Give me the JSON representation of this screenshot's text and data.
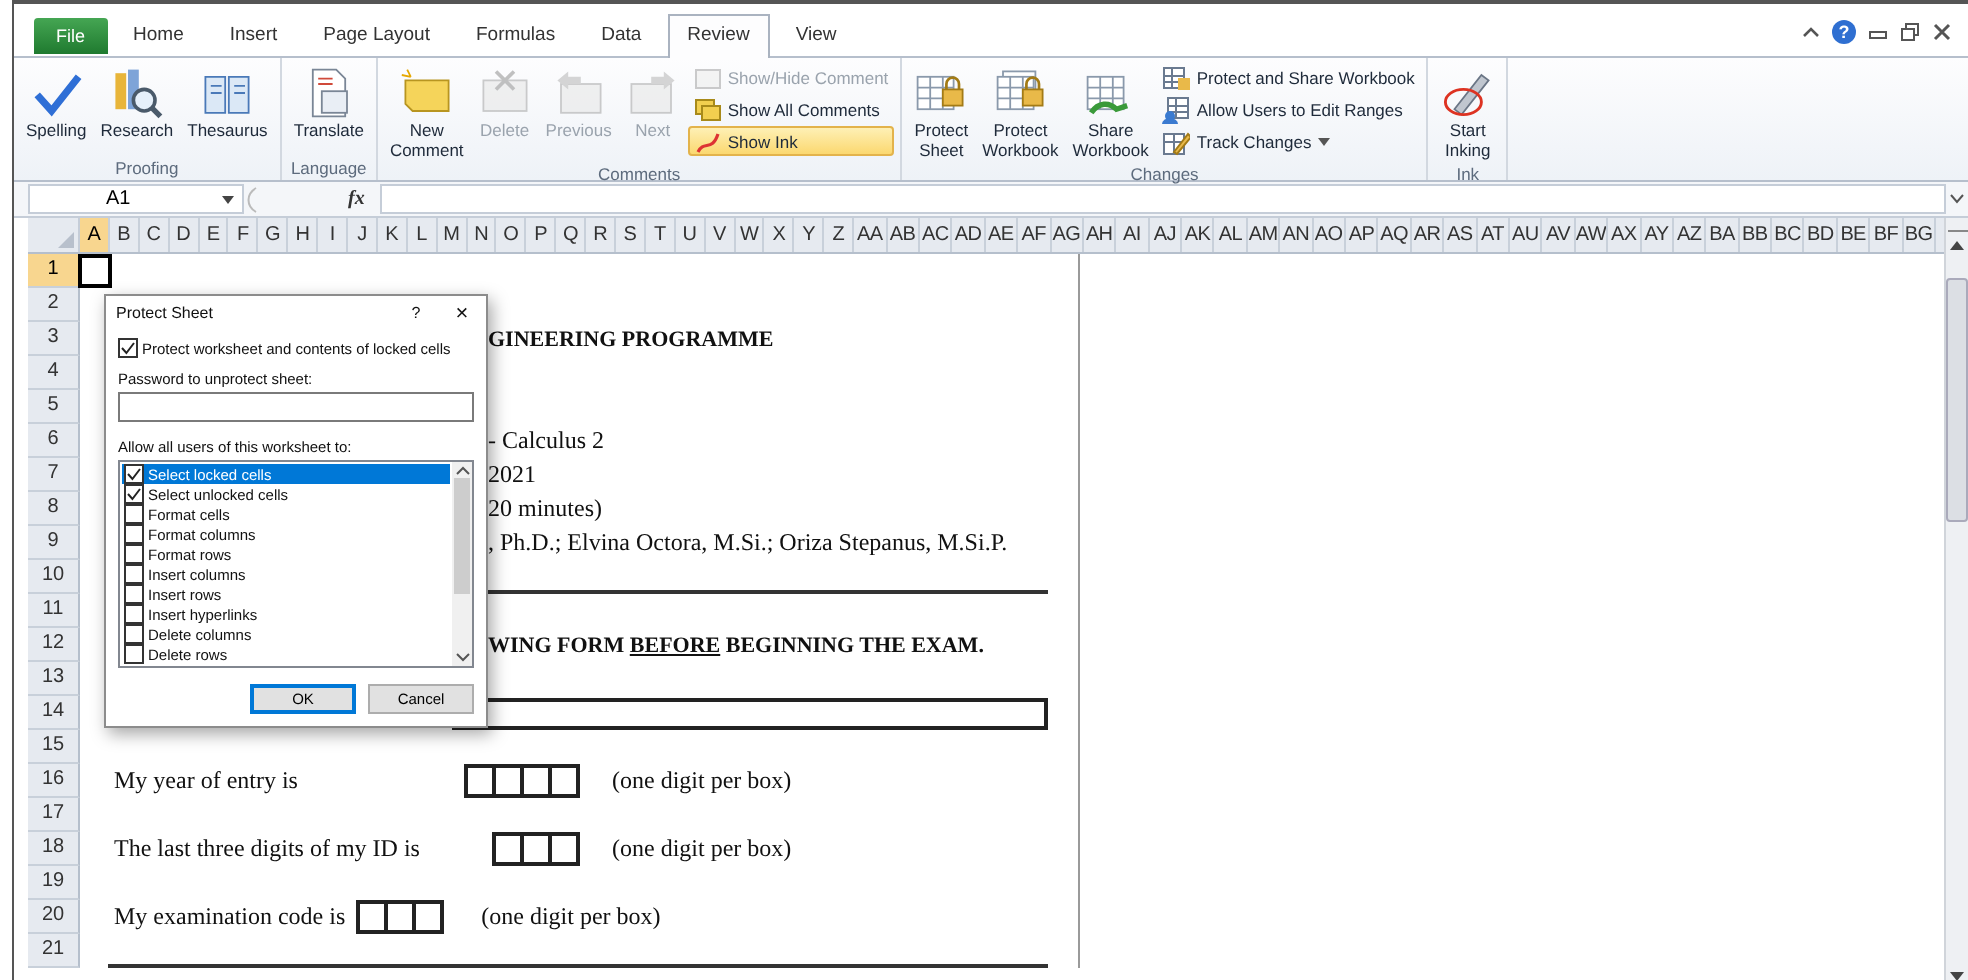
{
  "tabs": [
    {
      "label": "File",
      "kind": "file",
      "selected": false
    },
    {
      "label": "Home",
      "kind": "tab",
      "selected": false
    },
    {
      "label": "Insert",
      "kind": "tab",
      "selected": false
    },
    {
      "label": "Page Layout",
      "kind": "tab",
      "selected": false
    },
    {
      "label": "Formulas",
      "kind": "tab",
      "selected": false
    },
    {
      "label": "Data",
      "kind": "tab",
      "selected": false
    },
    {
      "label": "Review",
      "kind": "tab",
      "selected": true
    },
    {
      "label": "View",
      "kind": "tab",
      "selected": false
    }
  ],
  "help": "?",
  "ribbon": [
    {
      "label": "Proofing",
      "commands": [
        {
          "kind": "large",
          "lines": [
            "Spelling"
          ],
          "disabled": false,
          "on": false,
          "dropdown": false
        },
        {
          "kind": "large",
          "lines": [
            "Research"
          ],
          "disabled": false,
          "on": false,
          "dropdown": false
        },
        {
          "kind": "large",
          "lines": [
            "Thesaurus"
          ],
          "disabled": false,
          "on": false,
          "dropdown": false
        }
      ]
    },
    {
      "label": "Language",
      "commands": [
        {
          "kind": "large",
          "lines": [
            "Translate"
          ],
          "disabled": false,
          "on": false,
          "dropdown": false
        }
      ]
    },
    {
      "label": "Comments",
      "commands": [
        {
          "kind": "large",
          "lines": [
            "New",
            "Comment"
          ],
          "disabled": false,
          "on": false,
          "dropdown": false
        },
        {
          "kind": "large",
          "lines": [
            "Delete"
          ],
          "disabled": true,
          "on": false,
          "dropdown": false
        },
        {
          "kind": "large",
          "lines": [
            "Previous"
          ],
          "disabled": true,
          "on": false,
          "dropdown": false
        },
        {
          "kind": "large",
          "lines": [
            "Next"
          ],
          "disabled": true,
          "on": false,
          "dropdown": false
        },
        {
          "kind": "small",
          "lines": [
            "Show/Hide Comment"
          ],
          "disabled": true,
          "on": false,
          "dropdown": false
        },
        {
          "kind": "small",
          "lines": [
            "Show All Comments"
          ],
          "disabled": false,
          "on": false,
          "dropdown": false
        },
        {
          "kind": "small",
          "lines": [
            "Show Ink"
          ],
          "disabled": false,
          "on": true,
          "dropdown": false
        }
      ]
    },
    {
      "label": "Changes",
      "commands": [
        {
          "kind": "large",
          "lines": [
            "Protect",
            "Sheet"
          ],
          "disabled": false,
          "on": false,
          "dropdown": false
        },
        {
          "kind": "large",
          "lines": [
            "Protect",
            "Workbook"
          ],
          "disabled": false,
          "on": false,
          "dropdown": false
        },
        {
          "kind": "large",
          "lines": [
            "Share",
            "Workbook"
          ],
          "disabled": false,
          "on": false,
          "dropdown": false
        },
        {
          "kind": "small",
          "lines": [
            "Protect and Share Workbook"
          ],
          "disabled": false,
          "on": false,
          "dropdown": false
        },
        {
          "kind": "small",
          "lines": [
            "Allow Users to Edit Ranges"
          ],
          "disabled": false,
          "on": false,
          "dropdown": false
        },
        {
          "kind": "small",
          "lines": [
            "Track Changes"
          ],
          "disabled": false,
          "on": false,
          "dropdown": true
        }
      ]
    },
    {
      "label": "Ink",
      "commands": [
        {
          "kind": "large",
          "lines": [
            "Start",
            "Inking"
          ],
          "disabled": false,
          "on": false,
          "dropdown": false
        }
      ]
    }
  ],
  "formula_bar": {
    "name_box": "A1",
    "function_label": "fx"
  },
  "columns": [
    {
      "label": "A",
      "selected": true
    },
    {
      "label": "B",
      "selected": false
    },
    {
      "label": "C",
      "selected": false
    },
    {
      "label": "D",
      "selected": false
    },
    {
      "label": "E",
      "selected": false
    },
    {
      "label": "F",
      "selected": false
    },
    {
      "label": "G",
      "selected": false
    },
    {
      "label": "H",
      "selected": false
    },
    {
      "label": "I",
      "selected": false
    },
    {
      "label": "J",
      "selected": false
    },
    {
      "label": "K",
      "selected": false
    },
    {
      "label": "L",
      "selected": false
    },
    {
      "label": "M",
      "selected": false
    },
    {
      "label": "N",
      "selected": false
    },
    {
      "label": "O",
      "selected": false
    },
    {
      "label": "P",
      "selected": false
    },
    {
      "label": "Q",
      "selected": false
    },
    {
      "label": "R",
      "selected": false
    },
    {
      "label": "S",
      "selected": false
    },
    {
      "label": "T",
      "selected": false
    },
    {
      "label": "U",
      "selected": false
    },
    {
      "label": "V",
      "selected": false
    },
    {
      "label": "W",
      "selected": false
    },
    {
      "label": "X",
      "selected": false
    },
    {
      "label": "Y",
      "selected": false
    },
    {
      "label": "Z",
      "selected": false
    },
    {
      "label": "AA",
      "selected": false
    },
    {
      "label": "AB",
      "selected": false
    },
    {
      "label": "AC",
      "selected": false
    },
    {
      "label": "AD",
      "selected": false
    },
    {
      "label": "AE",
      "selected": false
    },
    {
      "label": "AF",
      "selected": false
    },
    {
      "label": "AG",
      "selected": false
    },
    {
      "label": "AH",
      "selected": false
    },
    {
      "label": "AI",
      "selected": false
    },
    {
      "label": "AJ",
      "selected": false
    },
    {
      "label": "AK",
      "selected": false
    },
    {
      "label": "AL",
      "selected": false
    },
    {
      "label": "AM",
      "selected": false
    },
    {
      "label": "AN",
      "selected": false
    },
    {
      "label": "AO",
      "selected": false
    },
    {
      "label": "AP",
      "selected": false
    },
    {
      "label": "AQ",
      "selected": false
    },
    {
      "label": "AR",
      "selected": false
    },
    {
      "label": "AS",
      "selected": false
    },
    {
      "label": "AT",
      "selected": false
    },
    {
      "label": "AU",
      "selected": false
    },
    {
      "label": "AV",
      "selected": false
    },
    {
      "label": "AW",
      "selected": false
    },
    {
      "label": "AX",
      "selected": false
    },
    {
      "label": "AY",
      "selected": false
    },
    {
      "label": "AZ",
      "selected": false
    },
    {
      "label": "BA",
      "selected": false
    },
    {
      "label": "BB",
      "selected": false
    },
    {
      "label": "BC",
      "selected": false
    },
    {
      "label": "BD",
      "selected": false
    },
    {
      "label": "BE",
      "selected": false
    },
    {
      "label": "BF",
      "selected": false
    },
    {
      "label": "BG",
      "selected": false
    }
  ],
  "rows": [
    {
      "label": "1",
      "selected": true
    },
    {
      "label": "2",
      "selected": false
    },
    {
      "label": "3",
      "selected": false,
      "content": [
        {
          "kind": "bold-text",
          "text": "GINEERING PROGRAMME"
        }
      ]
    },
    {
      "label": "4",
      "selected": false
    },
    {
      "label": "5",
      "selected": false
    },
    {
      "label": "6",
      "selected": false,
      "content": [
        {
          "kind": "text",
          "text": "- Calculus 2"
        }
      ]
    },
    {
      "label": "7",
      "selected": false,
      "content": [
        {
          "kind": "text",
          "text": "2021"
        }
      ]
    },
    {
      "label": "8",
      "selected": false,
      "content": [
        {
          "kind": "text",
          "text": "20 minutes)"
        }
      ]
    },
    {
      "label": "9",
      "selected": false,
      "content": [
        {
          "kind": "text",
          "text": ", Ph.D.; Elvina Octora, M.Si.; Oriza Stepanus, M.Si.P."
        }
      ]
    },
    {
      "label": "10",
      "selected": false,
      "content": [
        {
          "kind": "rule"
        }
      ]
    },
    {
      "label": "11",
      "selected": false
    },
    {
      "label": "12",
      "selected": false,
      "content": [
        {
          "kind": "notice",
          "before": "WING FORM ",
          "underlined": "BEFORE",
          "after": " BEGINNING THE EXAM."
        }
      ]
    },
    {
      "label": "13",
      "selected": false
    },
    {
      "label": "14",
      "selected": false,
      "content": [
        {
          "kind": "name-field"
        }
      ]
    },
    {
      "label": "15",
      "selected": false
    },
    {
      "label": "16",
      "selected": false,
      "content": [
        {
          "kind": "digit-row",
          "label": "My year of entry is",
          "boxes": [
            {
              "kind": "empty"
            },
            {
              "kind": "empty"
            },
            {
              "kind": "empty"
            },
            {
              "kind": "empty"
            }
          ],
          "hint": "(one digit per box)"
        }
      ]
    },
    {
      "label": "17",
      "selected": false
    },
    {
      "label": "18",
      "selected": false,
      "content": [
        {
          "kind": "digit-row",
          "label": "The last three digits of my ID is",
          "boxes": [
            {
              "kind": "empty"
            },
            {
              "kind": "empty"
            },
            {
              "kind": "empty"
            }
          ],
          "hint": "(one digit per box)"
        }
      ]
    },
    {
      "label": "19",
      "selected": false
    },
    {
      "label": "20",
      "selected": false,
      "content": [
        {
          "kind": "digit-row-inline",
          "label": "My examination code is",
          "boxes": [
            {
              "kind": "empty"
            },
            {
              "kind": "empty"
            },
            {
              "kind": "empty"
            }
          ],
          "hint": "(one digit per box)"
        }
      ]
    },
    {
      "label": "21",
      "selected": false,
      "content": [
        {
          "kind": "rule"
        }
      ]
    }
  ],
  "dialog": {
    "title": "Protect Sheet",
    "help": "?",
    "close": "×",
    "protect": {
      "label": "Protect worksheet and contents of locked cells",
      "checked": true
    },
    "password_label": "Password to unprotect sheet:",
    "permissions_label": "Allow all users of this worksheet to:",
    "permissions": [
      {
        "label": "Select locked cells",
        "checked": true,
        "selected": true
      },
      {
        "label": "Select unlocked cells",
        "checked": true,
        "selected": false
      },
      {
        "label": "Format cells",
        "checked": false,
        "selected": false
      },
      {
        "label": "Format columns",
        "checked": false,
        "selected": false
      },
      {
        "label": "Format rows",
        "checked": false,
        "selected": false
      },
      {
        "label": "Insert columns",
        "checked": false,
        "selected": false
      },
      {
        "label": "Insert rows",
        "checked": false,
        "selected": false
      },
      {
        "label": "Insert hyperlinks",
        "checked": false,
        "selected": false
      },
      {
        "label": "Delete columns",
        "checked": false,
        "selected": false
      },
      {
        "label": "Delete rows",
        "checked": false,
        "selected": false
      }
    ],
    "buttons": [
      {
        "label": "OK",
        "kind": "default"
      },
      {
        "label": "Cancel",
        "kind": "normal"
      }
    ]
  }
}
